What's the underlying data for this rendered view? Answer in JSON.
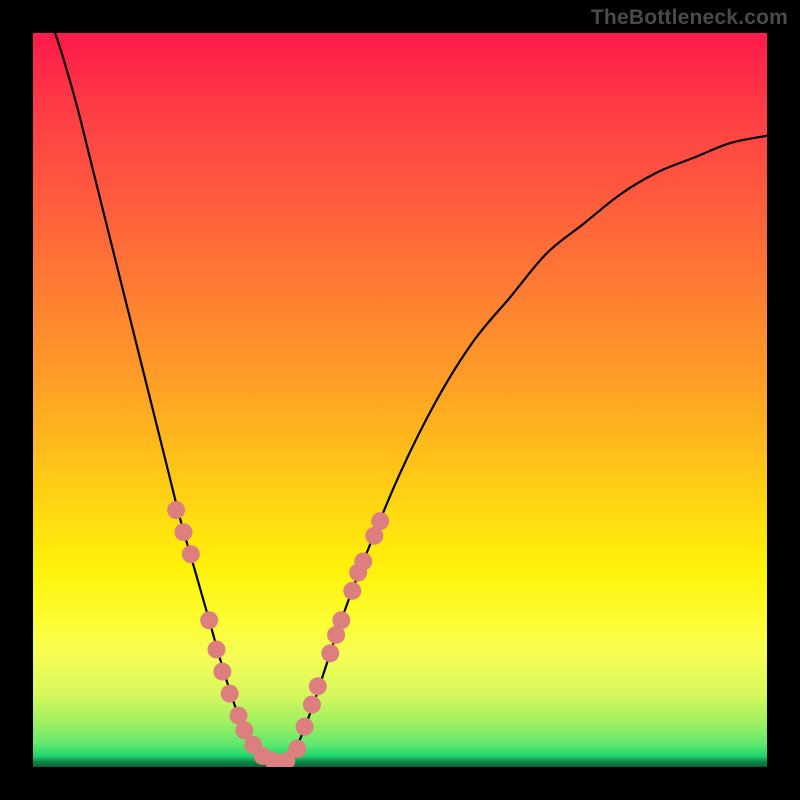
{
  "watermark": "TheBottleneck.com",
  "colors": {
    "page_bg": "#000000",
    "curve_stroke": "#000000",
    "marker_fill": "#dd7f7f",
    "gradient_top": "#ff1a4b",
    "gradient_mid": "#fff20a",
    "gradient_bottom": "#1fd46f"
  },
  "chart_data": {
    "type": "line",
    "title": "",
    "xlabel": "",
    "ylabel": "",
    "xlim": [
      0,
      100
    ],
    "ylim": [
      0,
      100
    ],
    "grid": false,
    "legend": false,
    "curve": [
      {
        "x": 3,
        "y": 100
      },
      {
        "x": 4,
        "y": 97
      },
      {
        "x": 6,
        "y": 90
      },
      {
        "x": 8,
        "y": 82
      },
      {
        "x": 10,
        "y": 74
      },
      {
        "x": 12,
        "y": 66
      },
      {
        "x": 14,
        "y": 58
      },
      {
        "x": 16,
        "y": 50
      },
      {
        "x": 18,
        "y": 42
      },
      {
        "x": 20,
        "y": 34
      },
      {
        "x": 22,
        "y": 27
      },
      {
        "x": 24,
        "y": 20
      },
      {
        "x": 26,
        "y": 13
      },
      {
        "x": 28,
        "y": 7
      },
      {
        "x": 30,
        "y": 3
      },
      {
        "x": 32,
        "y": 0.5
      },
      {
        "x": 34,
        "y": 0.5
      },
      {
        "x": 36,
        "y": 3
      },
      {
        "x": 38,
        "y": 8
      },
      {
        "x": 40,
        "y": 14
      },
      {
        "x": 42,
        "y": 20
      },
      {
        "x": 45,
        "y": 28
      },
      {
        "x": 50,
        "y": 40
      },
      {
        "x": 55,
        "y": 50
      },
      {
        "x": 60,
        "y": 58
      },
      {
        "x": 65,
        "y": 64
      },
      {
        "x": 70,
        "y": 70
      },
      {
        "x": 75,
        "y": 74
      },
      {
        "x": 80,
        "y": 78
      },
      {
        "x": 85,
        "y": 81
      },
      {
        "x": 90,
        "y": 83
      },
      {
        "x": 95,
        "y": 85
      },
      {
        "x": 100,
        "y": 86
      }
    ],
    "markers": [
      {
        "x": 19.5,
        "y": 35
      },
      {
        "x": 20.5,
        "y": 32
      },
      {
        "x": 21.5,
        "y": 29
      },
      {
        "x": 24.0,
        "y": 20
      },
      {
        "x": 25.0,
        "y": 16
      },
      {
        "x": 25.8,
        "y": 13
      },
      {
        "x": 26.8,
        "y": 10
      },
      {
        "x": 28.0,
        "y": 7
      },
      {
        "x": 28.8,
        "y": 5
      },
      {
        "x": 30.0,
        "y": 3
      },
      {
        "x": 31.3,
        "y": 1.5
      },
      {
        "x": 32.8,
        "y": 0.8
      },
      {
        "x": 34.5,
        "y": 0.8
      },
      {
        "x": 36.0,
        "y": 2.5
      },
      {
        "x": 37.0,
        "y": 5.5
      },
      {
        "x": 38.0,
        "y": 8.5
      },
      {
        "x": 38.8,
        "y": 11
      },
      {
        "x": 40.5,
        "y": 15.5
      },
      {
        "x": 41.3,
        "y": 18
      },
      {
        "x": 42.0,
        "y": 20
      },
      {
        "x": 43.5,
        "y": 24
      },
      {
        "x": 44.3,
        "y": 26.5
      },
      {
        "x": 45.0,
        "y": 28
      },
      {
        "x": 46.5,
        "y": 31.5
      },
      {
        "x": 47.3,
        "y": 33.5
      }
    ]
  }
}
